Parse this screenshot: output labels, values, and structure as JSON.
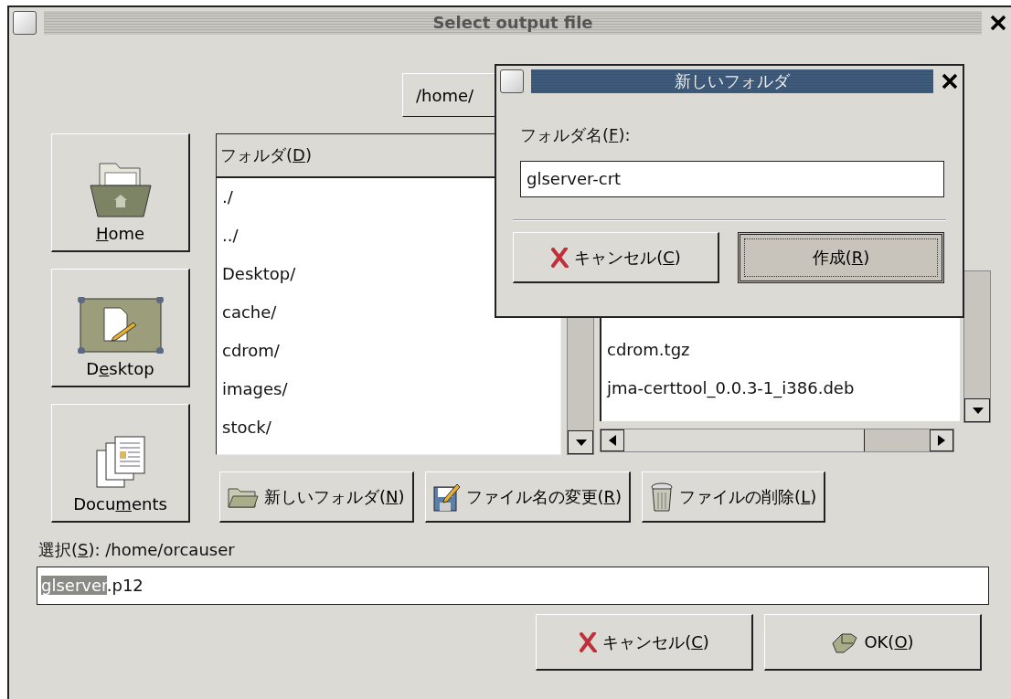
{
  "window": {
    "title": "Select output file"
  },
  "path_menu": {
    "value": "/home/"
  },
  "shortcuts": [
    {
      "kind": "home",
      "label_parts": {
        "key": "H",
        "post": "ome"
      }
    },
    {
      "kind": "desktop",
      "label_parts": {
        "pre": "D",
        "key": "e",
        "post": "sktop"
      }
    },
    {
      "kind": "documents",
      "label_parts": {
        "pre": "Docu",
        "key": "m",
        "post": "ents"
      }
    }
  ],
  "folders": {
    "header_parts": {
      "pre": "フォルダ(",
      "key": "D",
      "post": ")"
    },
    "items": [
      "./",
      "../",
      "Desktop/",
      "cache/",
      "cdrom/",
      "images/",
      "stock/"
    ]
  },
  "files": {
    "items": [
      "cdrom.tgz",
      "jma-certtool_0.0.3-1_i386.deb"
    ]
  },
  "file_buttons": [
    {
      "kind": "new-folder",
      "label_parts": {
        "pre": "新しいフォルダ(",
        "key": "N",
        "post": ")"
      }
    },
    {
      "kind": "rename",
      "label_parts": {
        "pre": "ファイル名の変更(",
        "key": "R",
        "post": ")"
      }
    },
    {
      "kind": "delete",
      "label_parts": {
        "pre": "ファイルの削除(",
        "key": "L",
        "post": ")"
      }
    }
  ],
  "selection": {
    "label_parts": {
      "pre": "選択(",
      "key": "S",
      "post": "): /home/orcauser"
    },
    "selected_text": "glserver",
    "rest": ".p12"
  },
  "buttons": [
    {
      "kind": "cancel",
      "label_parts": {
        "pre": "キャンセル(",
        "key": "C",
        "post": ")"
      }
    },
    {
      "kind": "ok",
      "label_parts": {
        "pre": "OK(",
        "key": "O",
        "post": ")"
      }
    }
  ],
  "dialog": {
    "title": "新しいフォルダ",
    "field_label_parts": {
      "pre": "フォルダ名(",
      "key": "F",
      "post": "):"
    },
    "value": "glserver-crt",
    "buttons": [
      {
        "kind": "cancel",
        "label_parts": {
          "pre": "キャンセル(",
          "key": "C",
          "post": ")"
        },
        "default": false
      },
      {
        "kind": "create",
        "label_parts": {
          "pre": "作成(",
          "key": "R",
          "post": ")"
        },
        "default": true
      }
    ]
  }
}
